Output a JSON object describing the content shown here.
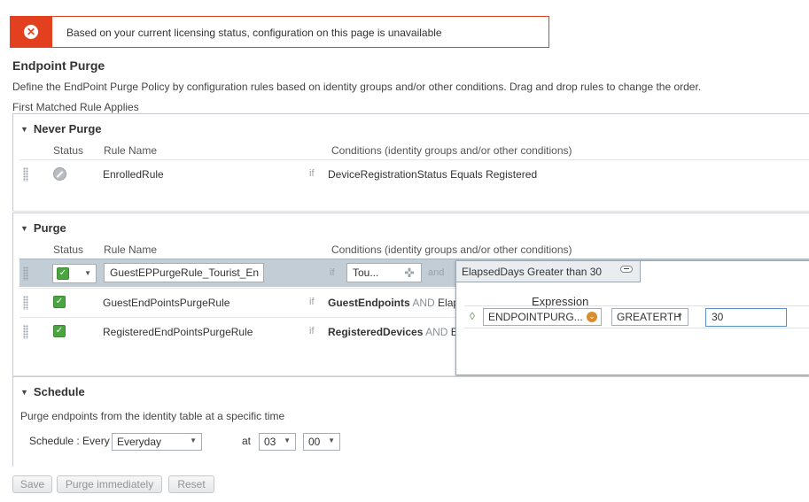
{
  "alert": {
    "icon": "error-icon",
    "message": "Based on your current licensing status, configuration on this page is unavailable"
  },
  "page": {
    "title": "Endpoint Purge",
    "description": "Define the EndPoint Purge Policy by configuration rules based on identity groups and/or other conditions. Drag and drop rules to change the order.",
    "first_matched": "First Matched Rule Applies"
  },
  "columns": {
    "status": "Status",
    "rule_name": "Rule Name",
    "conditions": "Conditions (identity groups and/or other conditions)"
  },
  "never_purge": {
    "title": "Never Purge",
    "rules": [
      {
        "name": "EnrolledRule",
        "if": "if",
        "condition": "DeviceRegistrationStatus Equals Registered"
      }
    ]
  },
  "purge": {
    "title": "Purge",
    "editing_rule": {
      "name_value": "GuestEPPurgeRule_Tourist_En",
      "if": "if",
      "group_value": "Tou...",
      "and": "and",
      "condition_tab": "ElapsedDays Greater than 30"
    },
    "rules": [
      {
        "name": "GuestEndPointsPurgeRule",
        "if": "if",
        "group": "GuestEndpoints",
        "and": "AND",
        "rest": "Elap"
      },
      {
        "name": "RegisteredEndPointsPurgeRule",
        "if": "if",
        "group": "RegisteredDevices",
        "and": "AND",
        "rest": "E"
      }
    ]
  },
  "expression": {
    "label": "Expression",
    "attribute": "ENDPOINTPURG...",
    "operator": "GREATERTH",
    "value": "30"
  },
  "schedule": {
    "title": "Schedule",
    "description": "Purge endpoints from the identity table at a specific time",
    "schedule_label": "Schedule : Every",
    "frequency": "Everyday",
    "at_label": "at",
    "hour": "03",
    "minute": "00"
  },
  "buttons": {
    "save": "Save",
    "purge_immediately": "Purge immediately",
    "reset": "Reset"
  },
  "colors": {
    "alert": "#e2401f",
    "check": "#4aa541",
    "selected_row": "#c3cdd5"
  }
}
